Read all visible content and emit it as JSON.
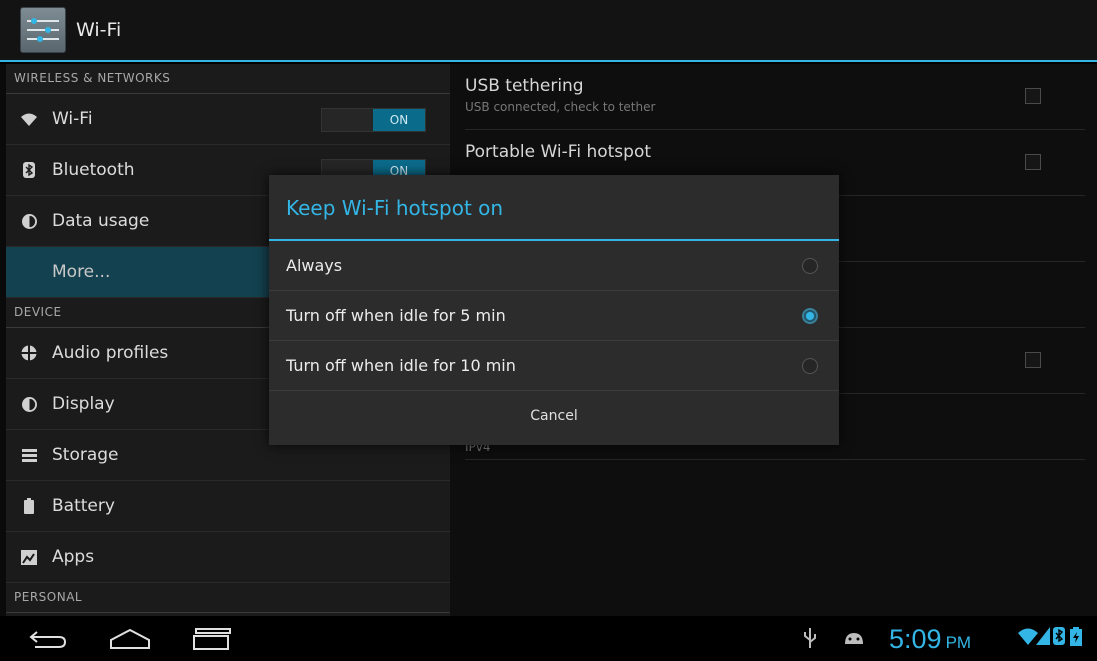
{
  "actionbar": {
    "title": "Wi-Fi",
    "icon": "settings-app-icon"
  },
  "left_pane": {
    "sections": [
      {
        "header": "WIRELESS & NETWORKS"
      },
      {
        "header": "DEVICE"
      },
      {
        "header": "PERSONAL"
      }
    ],
    "items": {
      "wifi": {
        "label": "Wi-Fi",
        "icon": "wifi-icon",
        "toggle": "ON"
      },
      "bluetooth": {
        "label": "Bluetooth",
        "icon": "bluetooth-icon",
        "toggle": "ON"
      },
      "data_usage": {
        "label": "Data usage",
        "icon": "pie-chart-icon"
      },
      "more": {
        "label": "More..."
      },
      "audio_profiles": {
        "label": "Audio profiles",
        "icon": "audio-profiles-icon"
      },
      "display": {
        "label": "Display",
        "icon": "display-icon"
      },
      "storage": {
        "label": "Storage",
        "icon": "storage-icon"
      },
      "battery": {
        "label": "Battery",
        "icon": "battery-icon"
      },
      "apps": {
        "label": "Apps",
        "icon": "apps-icon"
      }
    }
  },
  "right_pane": {
    "items": [
      {
        "title": "USB tethering",
        "summary": "USB connected, check to tether"
      },
      {
        "title": "Portable Wi-Fi hotspot",
        "summary": ""
      },
      {
        "title": "",
        "summary": ""
      },
      {
        "title": "",
        "summary": ""
      },
      {
        "title": "",
        "summary": ""
      },
      {
        "title": "",
        "summary": "IPv4"
      }
    ]
  },
  "dialog": {
    "title": "Keep Wi-Fi hotspot on",
    "options": [
      {
        "label": "Always",
        "checked": false
      },
      {
        "label": "Turn off when idle for 5 min",
        "checked": true
      },
      {
        "label": "Turn off when idle for 10 min",
        "checked": false
      }
    ],
    "cancel_label": "Cancel"
  },
  "system_bar": {
    "time": "5:09",
    "ampm": "PM",
    "icons": [
      "usb-icon",
      "android-debug-icon",
      "wifi-signal-icon",
      "cell-signal-icon",
      "bluetooth-status-icon",
      "battery-charging-icon"
    ],
    "accent": "#33b5e5"
  }
}
